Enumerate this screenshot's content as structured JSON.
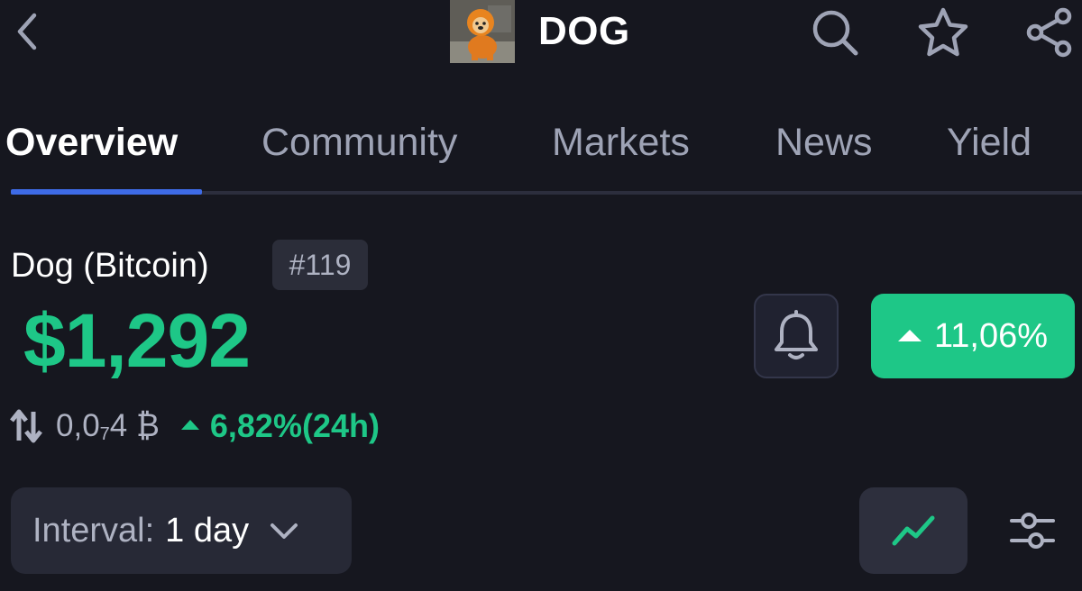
{
  "header": {
    "title": "DOG",
    "icons": [
      "back-chevron-icon",
      "search-icon",
      "star-icon",
      "share-icon"
    ]
  },
  "tabs": [
    {
      "label": "Overview",
      "active": true
    },
    {
      "label": "Community",
      "active": false
    },
    {
      "label": "Markets",
      "active": false
    },
    {
      "label": "News",
      "active": false
    },
    {
      "label": "Yield",
      "active": false
    }
  ],
  "coin": {
    "name": "Dog (Bitcoin)",
    "rank": "#119",
    "price": "$1,292",
    "change_badge": "11,06%",
    "btc_value_main": "0,0",
    "btc_value_sub": "7",
    "btc_value_end": "4 ₿",
    "change_24h": "6,82%(24h)"
  },
  "controls": {
    "interval_label": "Interval:",
    "interval_value": "1 day"
  },
  "colors": {
    "background": "#16171f",
    "accent_blue": "#3e6be6",
    "positive_green": "#1ec787",
    "muted_text": "#aeb2c2"
  }
}
